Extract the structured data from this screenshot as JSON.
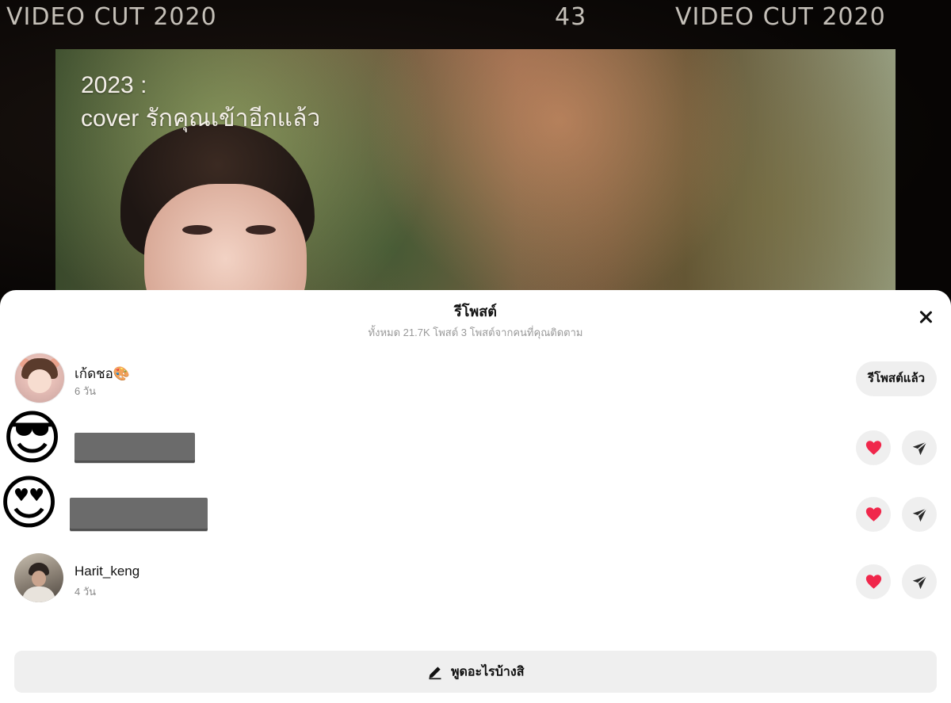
{
  "video": {
    "film_title_left": "VIDEO CUT 2020",
    "film_counter": "43",
    "film_title_right": "VIDEO CUT 2020",
    "overlay_year": "2023 :",
    "overlay_cover": "cover รักคุณเข้าอีกแล้ว"
  },
  "sheet": {
    "title": "รีโพสต์",
    "subtitle": "ทั้งหมด 21.7K โพสต์ 3 โพสต์จากคนที่คุณติดตาม",
    "close_icon": "close-icon",
    "compose_label": "พูดอะไรบ้างสิ",
    "compose_icon": "pencil-icon"
  },
  "reposts": [
    {
      "username": "เก้ดชอ🎨",
      "time": "6 วัน",
      "action_label": "รีโพสต์แล้ว"
    },
    {
      "emoji": "😎",
      "name_redacted": true
    },
    {
      "emoji": "😍",
      "name_redacted": true
    },
    {
      "username": "Harit_keng",
      "time": "4 วัน"
    }
  ],
  "colors": {
    "heart": "#f0274b",
    "button_bg": "#efefef",
    "text_primary": "#111111",
    "text_secondary": "#888888"
  }
}
